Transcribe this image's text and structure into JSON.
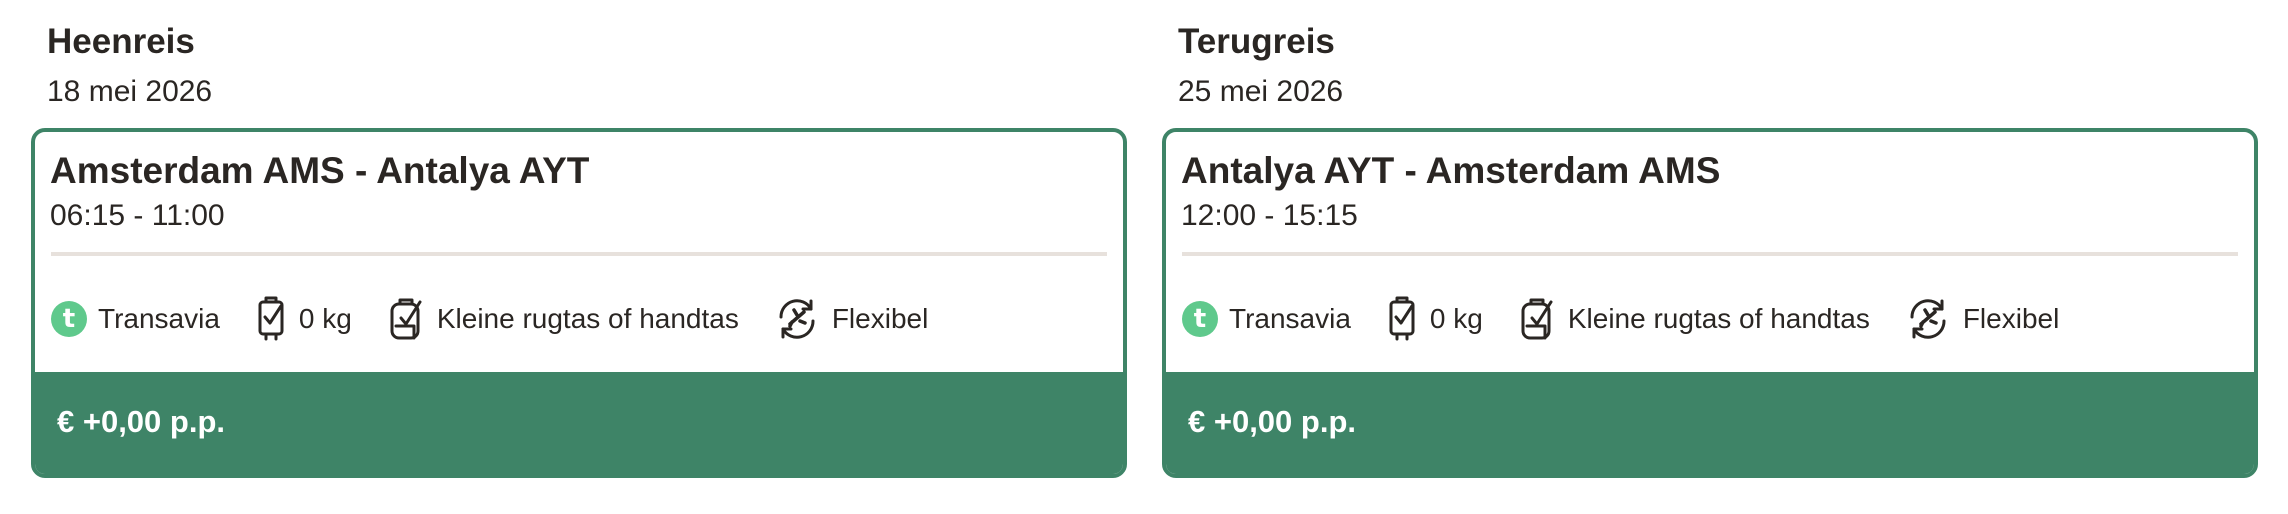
{
  "outbound": {
    "heading": "Heenreis",
    "date": "18 mei 2026",
    "route": "Amsterdam AMS - Antalya AYT",
    "times": "06:15 - 11:00",
    "airline": "Transavia",
    "airline_icon": "transavia-logo-icon",
    "checked_baggage": "0 kg",
    "cabin_baggage": "Kleine rugtas of handtas",
    "flexibility": "Flexibel",
    "price": "€ +0,00 p.p."
  },
  "return": {
    "heading": "Terugreis",
    "date": "25 mei 2026",
    "route": "Antalya AYT - Amsterdam AMS",
    "times": "12:00 - 15:15",
    "airline": "Transavia",
    "airline_icon": "transavia-logo-icon",
    "checked_baggage": "0 kg",
    "cabin_baggage": "Kleine rugtas of handtas",
    "flexibility": "Flexibel",
    "price": "€ +0,00 p.p."
  },
  "colors": {
    "accent": "#3e8467",
    "airline_logo": "#5fc98c",
    "divider": "#e7e1dc",
    "text": "#2a2623"
  }
}
